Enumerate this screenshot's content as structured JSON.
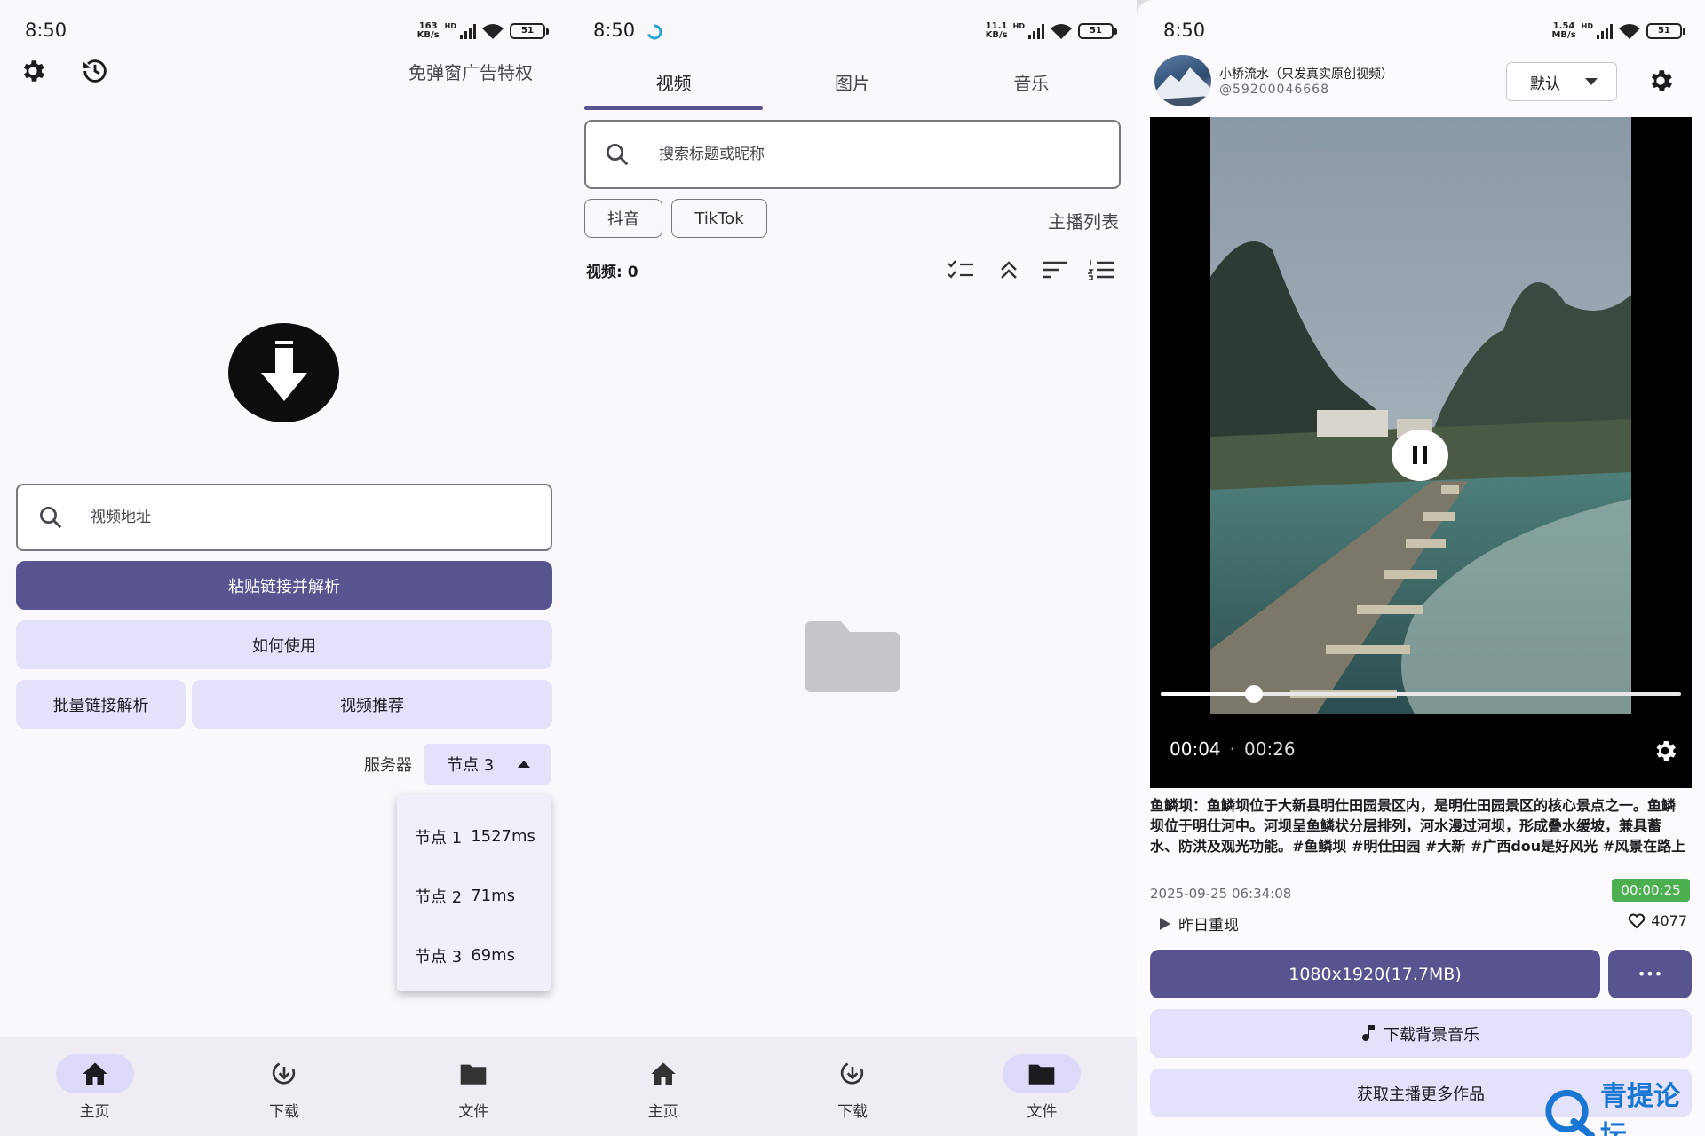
{
  "status": {
    "s1": {
      "time": "8:50",
      "net_top": "163",
      "net_unit": "KB/s",
      "battery": "51"
    },
    "s2": {
      "time": "8:50",
      "net_top": "11.1",
      "net_unit": "KB/s",
      "battery": "51"
    },
    "s3": {
      "time": "8:50",
      "net_top": "1.54",
      "net_unit": "MB/s",
      "battery": "51"
    },
    "hd": "HD"
  },
  "home": {
    "ad_free_link": "免弹窗广告特权",
    "url_placeholder": "视频地址",
    "paste_button": "粘贴链接并解析",
    "howto_button": "如何使用",
    "batch_button": "批量链接解析",
    "recommend_button": "视频推荐",
    "server_label": "服务器",
    "server_selected": "节点 3",
    "server_options": [
      {
        "name": "节点 1",
        "latency": "1527ms"
      },
      {
        "name": "节点 2",
        "latency": "71ms"
      },
      {
        "name": "节点 3",
        "latency": "69ms"
      }
    ]
  },
  "files": {
    "tabs": [
      "视频",
      "图片",
      "音乐"
    ],
    "search_placeholder": "搜索标题或昵称",
    "chips": [
      "抖音",
      "TikTok"
    ],
    "anchor_list": "主播列表",
    "count_label": "视频: 0"
  },
  "nav": {
    "home": "主页",
    "download": "下载",
    "files": "文件"
  },
  "player": {
    "author": "小桥流水（只发真实原创视频）",
    "author_id": "@59200046668",
    "sort": "默认",
    "current_time": "00:04",
    "separator": "·",
    "total_time": "00:26",
    "progress": 0.18,
    "description": "鱼鳞坝：鱼鳞坝位于大新县明仕田园景区内，是明仕田园景区的核心景点之一。鱼鳞坝位于明仕河中。河坝呈鱼鳞状分层排列，河水漫过河坝，形成叠水缓坡，兼具蓄水、防洪及观光功能。#鱼鳞坝 #明仕田园 #大新 #广西dou是好风光 #风景在路上",
    "date": "2025-09-25 06:34:08",
    "duration": "00:00:25",
    "replay": "昨日重现",
    "likes": "4077",
    "download_button": "1080x1920(17.7MB)",
    "more_button": "•••",
    "music_button": "下载背景音乐",
    "more_works_button": "获取主播更多作品",
    "watermark": "青提论坛"
  },
  "colors": {
    "primary": "#57548f",
    "tonal": "#e4e1fb",
    "duration_badge": "#4caf50",
    "watermark": "#1976d2"
  }
}
